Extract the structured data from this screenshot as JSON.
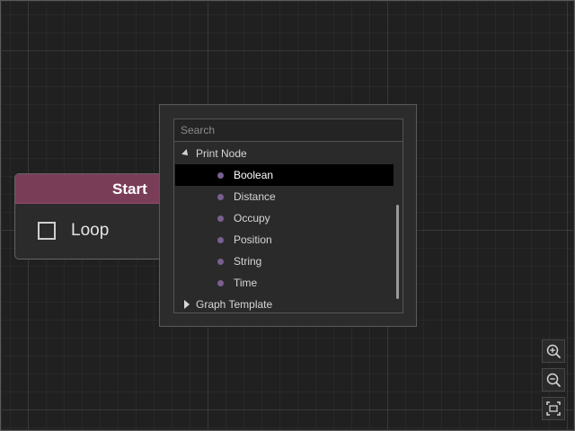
{
  "node": {
    "title": "Start",
    "loop_label": "Loop",
    "header_color": "#7a3d58"
  },
  "popup": {
    "search": {
      "placeholder": "Search",
      "value": ""
    },
    "groups": [
      {
        "label": "Print Node",
        "expanded": true,
        "items": [
          {
            "label": "Boolean",
            "selected": true
          },
          {
            "label": "Distance",
            "selected": false
          },
          {
            "label": "Occupy",
            "selected": false
          },
          {
            "label": "Position",
            "selected": false
          },
          {
            "label": "String",
            "selected": false
          },
          {
            "label": "Time",
            "selected": false
          }
        ]
      },
      {
        "label": "Graph Template",
        "expanded": false,
        "items": []
      }
    ]
  },
  "zoom_controls": {
    "zoom_in_icon": "zoom-in-icon",
    "zoom_out_icon": "zoom-out-icon",
    "fit_icon": "fit-view-icon"
  },
  "colors": {
    "canvas": "#202020",
    "selection": "#000000",
    "bullet": "#7b5f8f"
  }
}
